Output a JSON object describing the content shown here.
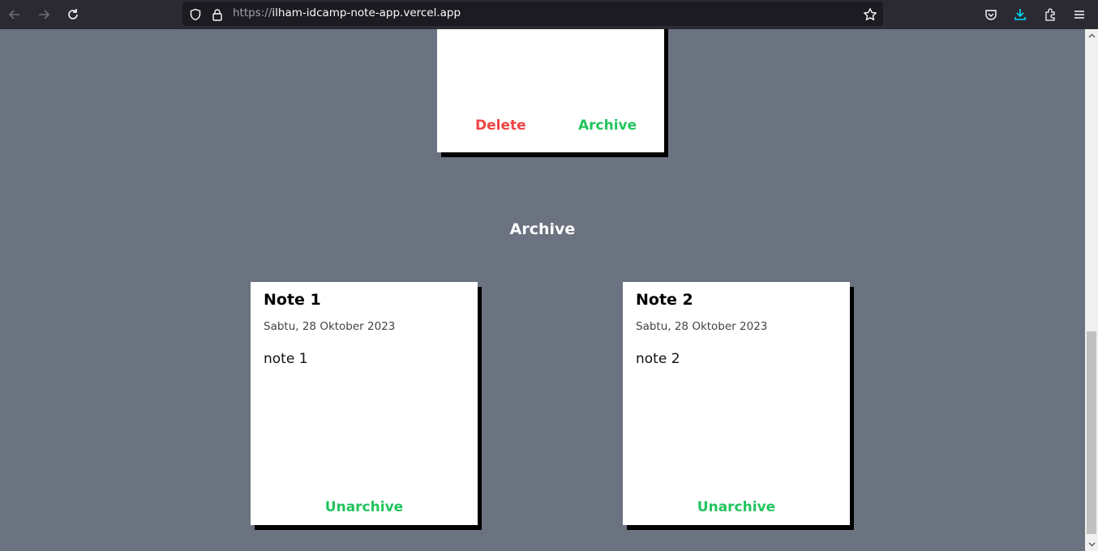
{
  "browser": {
    "url_scheme": "https://",
    "url_host": "ilham-idcamp-note-app.vercel.app",
    "icons": [
      "back-arrow-icon",
      "forward-arrow-icon",
      "reload-icon",
      "shield-icon",
      "lock-icon",
      "star-icon",
      "pocket-icon",
      "download-icon",
      "extensions-icon",
      "menu-icon"
    ]
  },
  "colors": {
    "page_bg": "#6b7280",
    "delete": "#ef4444",
    "archive": "#22c55e",
    "download_accent": "#00ddff"
  },
  "active_note_partial": {
    "delete_label": "Delete",
    "archive_label": "Archive"
  },
  "archive_section": {
    "heading": "Archive",
    "notes": [
      {
        "title": "Note 1",
        "date": "Sabtu, 28 Oktober 2023",
        "body": "note 1",
        "unarchive_label": "Unarchive"
      },
      {
        "title": "Note 2",
        "date": "Sabtu, 28 Oktober 2023",
        "body": "note 2",
        "unarchive_label": "Unarchive"
      }
    ]
  }
}
